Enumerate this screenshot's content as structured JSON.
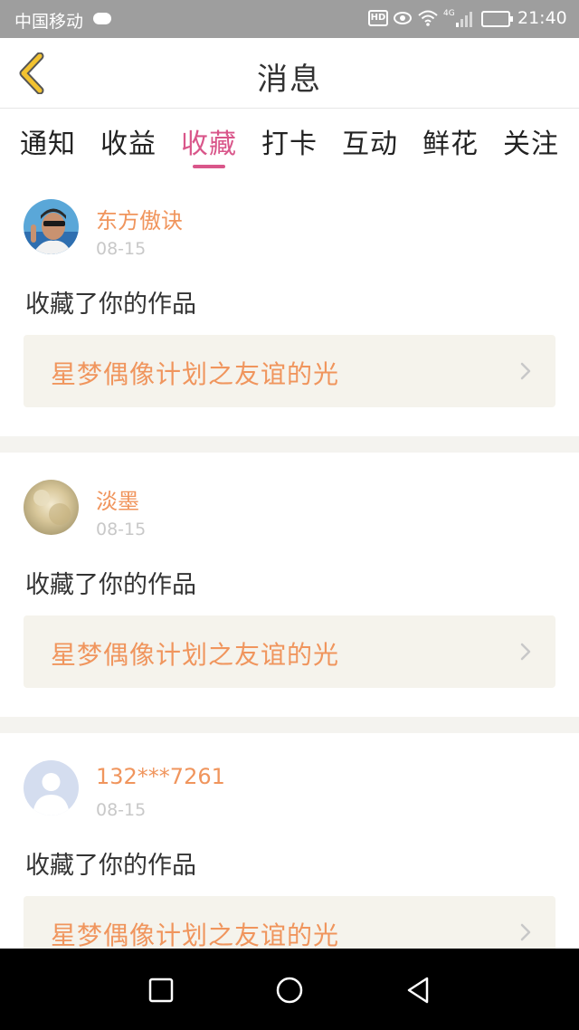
{
  "status_bar": {
    "carrier": "中国移动",
    "hd": "HD",
    "network": "4G",
    "time": "21:40"
  },
  "header": {
    "title": "消息"
  },
  "tabs": [
    {
      "label": "通知",
      "active": false
    },
    {
      "label": "收益",
      "active": false
    },
    {
      "label": "收藏",
      "active": true
    },
    {
      "label": "打卡",
      "active": false
    },
    {
      "label": "互动",
      "active": false
    },
    {
      "label": "鲜花",
      "active": false
    },
    {
      "label": "关注",
      "active": false
    }
  ],
  "items": [
    {
      "username": "东方傲诀",
      "date": "08-15",
      "action": "收藏了你的作品",
      "work_title": "星梦偶像计划之友谊的光"
    },
    {
      "username": "淡墨",
      "date": "08-15",
      "action": "收藏了你的作品",
      "work_title": "星梦偶像计划之友谊的光"
    },
    {
      "username": "132***7261",
      "date": "08-15",
      "action": "收藏了你的作品",
      "work_title": "星梦偶像计划之友谊的光"
    }
  ],
  "colors": {
    "accent": "#d9568a",
    "username": "#f0955d",
    "back_icon": "#f2c230"
  },
  "icons": {
    "back": "back-chevron-icon",
    "row_link": "chevron-right-icon",
    "nav": [
      "recent-apps-icon",
      "home-icon",
      "back-triangle-icon"
    ]
  }
}
